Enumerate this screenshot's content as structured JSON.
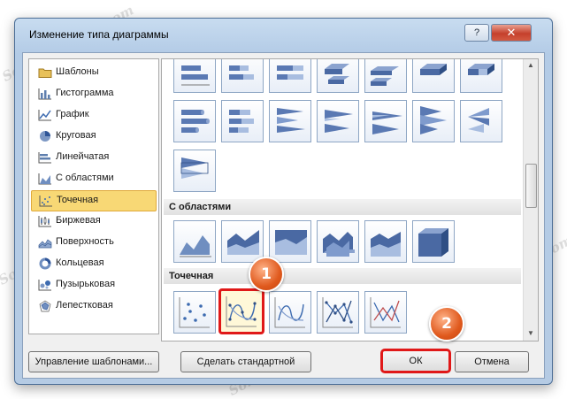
{
  "dialog": {
    "title": "Изменение типа диаграммы",
    "help_label": "?",
    "close_label": "✕"
  },
  "chart_types": [
    {
      "label": "Шаблоны",
      "icon": "folder-icon",
      "selected": false
    },
    {
      "label": "Гистограмма",
      "icon": "column-chart-icon",
      "selected": false
    },
    {
      "label": "График",
      "icon": "line-chart-icon",
      "selected": false
    },
    {
      "label": "Круговая",
      "icon": "pie-chart-icon",
      "selected": false
    },
    {
      "label": "Линейчатая",
      "icon": "bar-chart-icon",
      "selected": false
    },
    {
      "label": "С областями",
      "icon": "area-chart-icon",
      "selected": false
    },
    {
      "label": "Точечная",
      "icon": "scatter-chart-icon",
      "selected": true
    },
    {
      "label": "Биржевая",
      "icon": "stock-chart-icon",
      "selected": false
    },
    {
      "label": "Поверхность",
      "icon": "surface-chart-icon",
      "selected": false
    },
    {
      "label": "Кольцевая",
      "icon": "doughnut-chart-icon",
      "selected": false
    },
    {
      "label": "Пузырьковая",
      "icon": "bubble-chart-icon",
      "selected": false
    },
    {
      "label": "Лепестковая",
      "icon": "radar-chart-icon",
      "selected": false
    }
  ],
  "gallery": {
    "sections": {
      "area": "С областями",
      "scatter": "Точечная"
    },
    "selected_subtype": "scatter-smooth-lines-markers"
  },
  "buttons": {
    "manage_templates": "Управление шаблонами...",
    "set_default": "Сделать стандартной",
    "ok": "ОК",
    "cancel": "Отмена"
  },
  "callouts": {
    "one": "1",
    "two": "2"
  },
  "watermark": "Soringpcrepair.com",
  "colors": {
    "selection_fill": "#f8d875",
    "callout_orange": "#e05a1e",
    "highlight_red": "#e01818"
  }
}
